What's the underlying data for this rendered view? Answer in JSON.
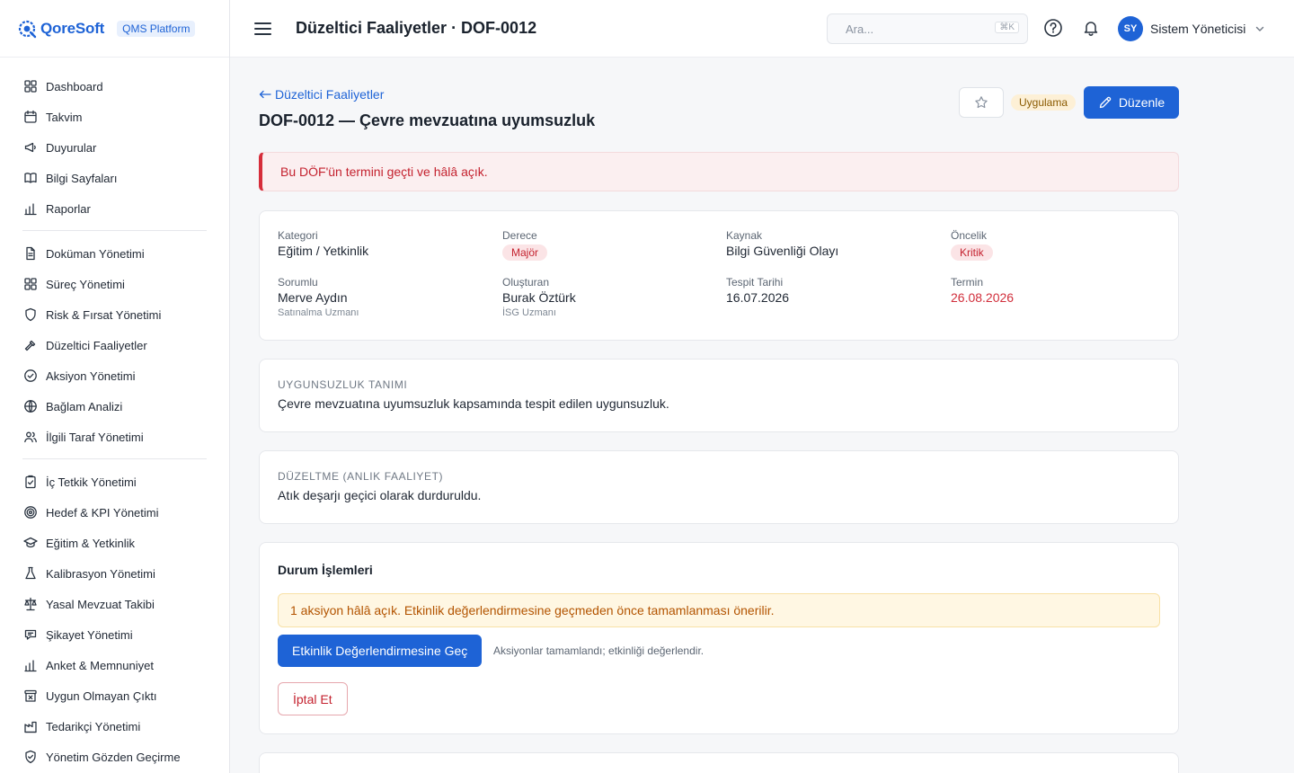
{
  "brand": {
    "name": "QoreSoft",
    "badge": "QMS Platform"
  },
  "sidebar": {
    "groups": [
      [
        {
          "label": "Dashboard",
          "icon": "grid-icon"
        },
        {
          "label": "Takvim",
          "icon": "calendar-icon"
        },
        {
          "label": "Duyurular",
          "icon": "megaphone-icon"
        },
        {
          "label": "Bilgi Sayfaları",
          "icon": "book-icon"
        },
        {
          "label": "Raporlar",
          "icon": "bar-chart-icon"
        }
      ],
      [
        {
          "label": "Doküman Yönetimi",
          "icon": "document-icon"
        },
        {
          "label": "Süreç Yönetimi",
          "icon": "grid-icon"
        },
        {
          "label": "Risk & Fırsat Yönetimi",
          "icon": "shield-icon"
        },
        {
          "label": "Düzeltici Faaliyetler",
          "icon": "hammer-icon"
        },
        {
          "label": "Aksiyon Yönetimi",
          "icon": "check-circle-icon"
        },
        {
          "label": "Bağlam Analizi",
          "icon": "globe-icon"
        },
        {
          "label": "İlgili Taraf Yönetimi",
          "icon": "users-icon"
        }
      ],
      [
        {
          "label": "İç Tetkik Yönetimi",
          "icon": "clipboard-check-icon"
        },
        {
          "label": "Hedef & KPI Yönetimi",
          "icon": "target-icon"
        },
        {
          "label": "Eğitim & Yetkinlik",
          "icon": "graduation-cap-icon"
        },
        {
          "label": "Kalibrasyon Yönetimi",
          "icon": "flask-icon"
        },
        {
          "label": "Yasal Mevzuat Takibi",
          "icon": "scale-icon"
        },
        {
          "label": "Şikayet Yönetimi",
          "icon": "speech-icon"
        },
        {
          "label": "Anket & Memnuniyet",
          "icon": "bar-chart-icon"
        },
        {
          "label": "Uygun Olmayan Çıktı",
          "icon": "archive-x-icon"
        },
        {
          "label": "Tedarikçi Yönetimi",
          "icon": "factory-icon"
        },
        {
          "label": "Yönetim Gözden Geçirme",
          "icon": "shield-check-icon"
        }
      ]
    ]
  },
  "header": {
    "title": "Düzeltici Faaliyetler · DOF-0012",
    "search_placeholder": "Ara...",
    "search_shortcut": "⌘K",
    "user_initials": "SY",
    "user_name": "Sistem Yöneticisi"
  },
  "page": {
    "back_label": "Düzeltici Faaliyetler",
    "title": "DOF-0012 — Çevre mevzuatına uyumsuzluk",
    "status": "Uygulama",
    "edit_label": "Düzenle",
    "overdue_alert": "Bu DÖF'ün termini geçti ve hâlâ açık."
  },
  "info": {
    "kategori": {
      "label": "Kategori",
      "value": "Eğitim / Yetkinlik"
    },
    "derece": {
      "label": "Derece",
      "value": "Majör"
    },
    "kaynak": {
      "label": "Kaynak",
      "value": "Bilgi Güvenliği Olayı"
    },
    "oncelik": {
      "label": "Öncelik",
      "value": "Kritik"
    },
    "sorumlu": {
      "label": "Sorumlu",
      "value": "Merve Aydın",
      "sub": "Satınalma Uzmanı"
    },
    "olusturan": {
      "label": "Oluşturan",
      "value": "Burak Öztürk",
      "sub": "İSG Uzmanı"
    },
    "tespit": {
      "label": "Tespit Tarihi",
      "value": "16.07.2026"
    },
    "termin": {
      "label": "Termin",
      "value": "26.08.2026"
    }
  },
  "nonconformity": {
    "label": "Uygunsuzluk Tanımı",
    "text": "Çevre mevzuatına uyumsuzluk kapsamında tespit edilen uygunsuzluk."
  },
  "correction": {
    "label": "Düzeltme (Anlık Faaliyet)",
    "text": "Atık deşarjı geçici olarak durduruldu."
  },
  "status_actions": {
    "title": "Durum İşlemleri",
    "warning": "1 aksiyon hâlâ açık. Etkinlik değerlendirmesine geçmeden önce tamamlanması önerilir.",
    "primary_label": "Etkinlik Değerlendirmesine Geç",
    "hint": "Aksiyonlar tamamlandı; etkinliği değerlendir.",
    "cancel_label": "İptal Et"
  },
  "colors": {
    "accent": "#1e63d6",
    "danger": "#d62d3a",
    "warning_bg": "#fff7e3",
    "status_pill_bg": "#fdf0d6"
  }
}
